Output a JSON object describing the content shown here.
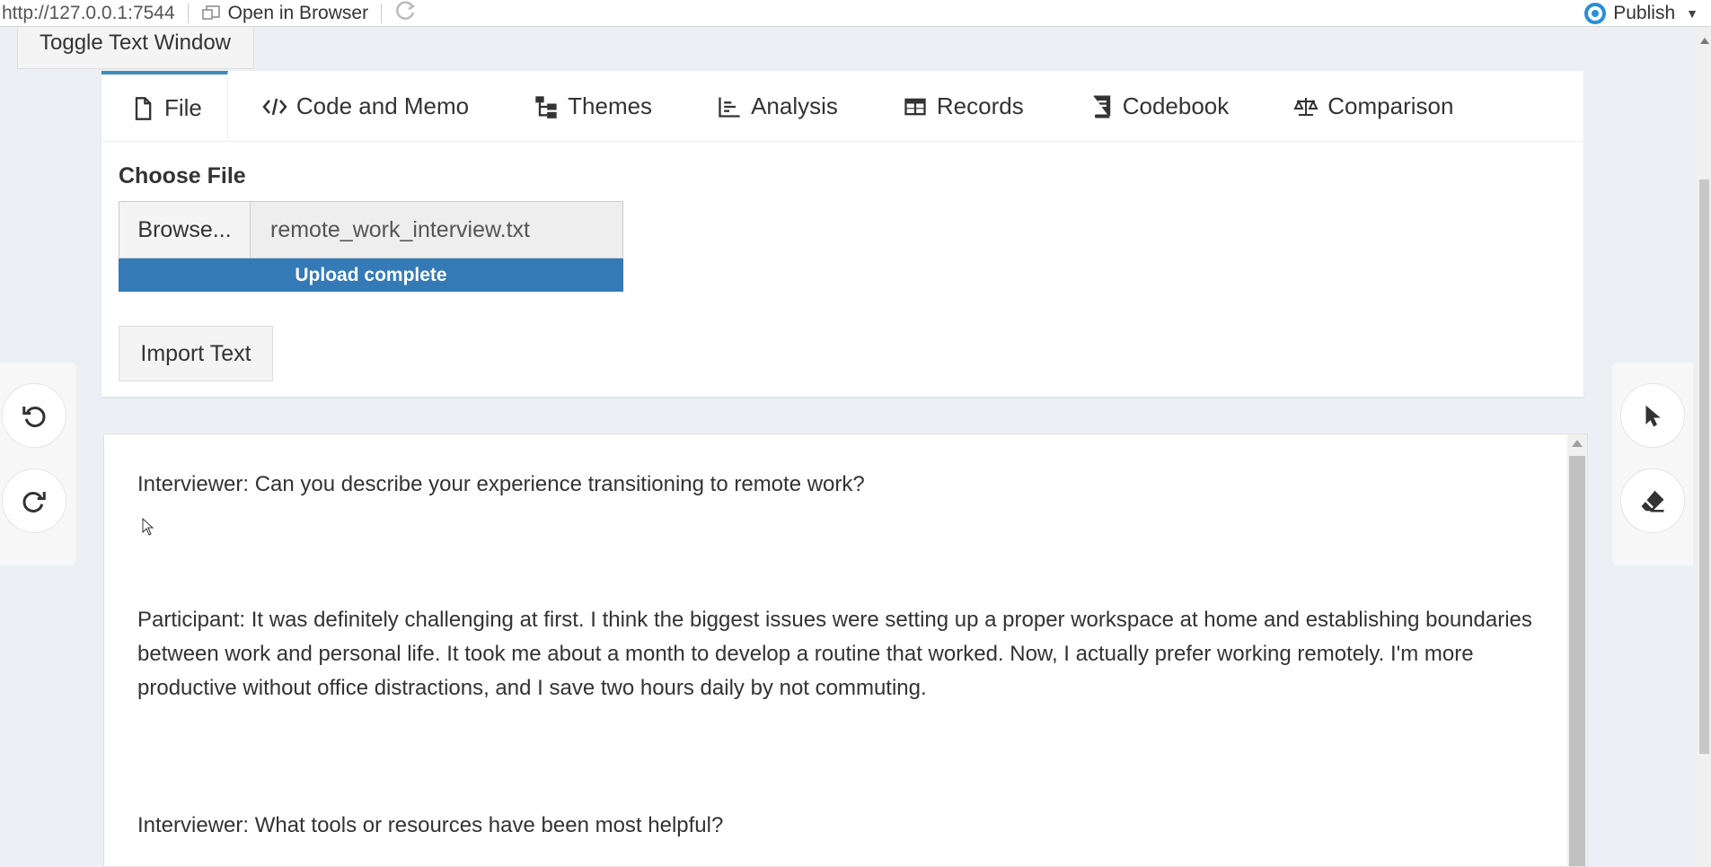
{
  "topbar": {
    "url": "http://127.0.0.1:7544",
    "open_in_browser": "Open in Browser",
    "publish": "Publish"
  },
  "toggle_text_window": "Toggle Text Window",
  "tabs": [
    {
      "label": "File",
      "icon": "file-icon"
    },
    {
      "label": "Code and Memo",
      "icon": "code-icon"
    },
    {
      "label": "Themes",
      "icon": "sitemap-icon"
    },
    {
      "label": "Analysis",
      "icon": "chart-icon"
    },
    {
      "label": "Records",
      "icon": "table-icon"
    },
    {
      "label": "Codebook",
      "icon": "book-icon"
    },
    {
      "label": "Comparison",
      "icon": "balance-scale-icon"
    }
  ],
  "file_panel": {
    "choose_label": "Choose File",
    "browse_label": "Browse...",
    "filename": "remote_work_interview.txt",
    "upload_status": "Upload complete",
    "upload_progress": 1.0,
    "import_label": "Import Text"
  },
  "text_window": {
    "paragraphs": [
      "Interviewer: Can you describe your experience transitioning to remote work?",
      "Participant: It was definitely challenging at first. I think the biggest issues were setting up a proper workspace at home and establishing boundaries between work and personal life. It took me about a month to develop a routine that worked. Now, I actually prefer working remotely. I'm more productive without office distractions, and I save two hours daily by not commuting.",
      "Interviewer: What tools or resources have been most helpful?"
    ]
  },
  "colors": {
    "accent": "#3c8dbc",
    "progress": "#337ab7",
    "publish_icon": "#2a8fd8",
    "background": "#ecf0f5"
  }
}
